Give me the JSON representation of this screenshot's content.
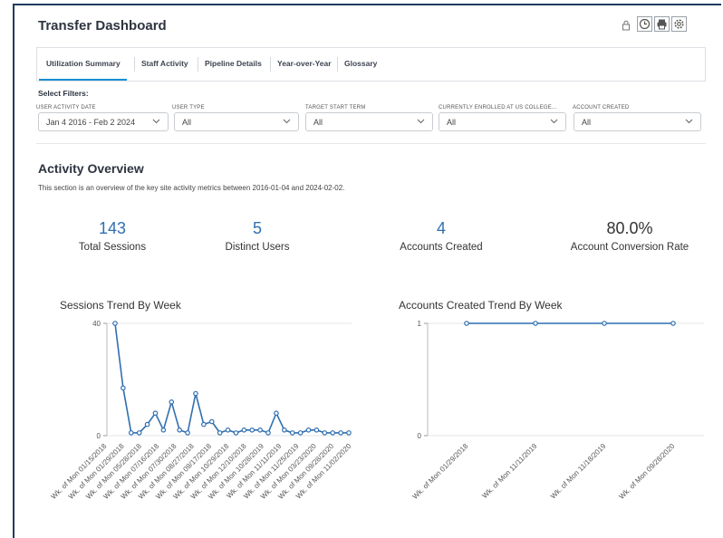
{
  "header": {
    "title": "Transfer Dashboard"
  },
  "toolbar": {
    "icons": [
      "lock-icon",
      "clock-icon",
      "print-icon",
      "gear-icon"
    ]
  },
  "tabs": [
    {
      "label": "Utilization Summary",
      "active": true
    },
    {
      "label": "Staff Activity",
      "active": false
    },
    {
      "label": "Pipeline Details",
      "active": false
    },
    {
      "label": "Year-over-Year",
      "active": false
    },
    {
      "label": "Glossary",
      "active": false
    }
  ],
  "filters": {
    "title": "Select Filters:",
    "items": [
      {
        "label": "USER ACTIVITY DATE",
        "value": "Jan 4 2016 - Feb 2 2024"
      },
      {
        "label": "USER TYPE",
        "value": "All"
      },
      {
        "label": "TARGET START TERM",
        "value": "All"
      },
      {
        "label": "CURRENTLY ENROLLED AT US COLLEGE...",
        "value": "All"
      },
      {
        "label": "ACCOUNT CREATED",
        "value": "All"
      }
    ]
  },
  "overview": {
    "title": "Activity Overview",
    "description": "This section is an overview of the key site activity metrics between 2016-01-04 and 2024-02-02.",
    "kpis": [
      {
        "value": "143",
        "label": "Total Sessions"
      },
      {
        "value": "5",
        "label": "Distinct Users"
      },
      {
        "value": "4",
        "label": "Accounts Created"
      },
      {
        "value": "80.0%",
        "label": "Account Conversion Rate"
      }
    ]
  },
  "colors": {
    "accent": "#1a8fd6",
    "series": "#2f6fb0",
    "kpi": "#2f6fb0"
  },
  "chart_data": [
    {
      "type": "line",
      "title": "Sessions Trend By Week",
      "ylim": [
        0,
        40
      ],
      "yticks": [
        0,
        40
      ],
      "grid": true,
      "x_tick_labels": [
        "Wk. of Mon 01/15/2018",
        "Wk. of Mon 01/29/2018",
        "Wk. of Mon 05/28/2018",
        "Wk. of Mon 07/16/2018",
        "Wk. of Mon 07/30/2018",
        "Wk. of Mon 08/27/2018",
        "Wk. of Mon 09/17/2018",
        "Wk. of Mon 10/29/2018",
        "Wk. of Mon 12/10/2018",
        "Wk. of Mon 10/28/2019",
        "Wk. of Mon 11/11/2019",
        "Wk. of Mon 11/25/2019",
        "Wk. of Mon 03/23/2020",
        "Wk. of Mon 09/28/2020",
        "Wk. of Mon 11/02/2020"
      ],
      "values": [
        40,
        17,
        1,
        1,
        4,
        8,
        2,
        12,
        2,
        1,
        15,
        4,
        5,
        1,
        2,
        1,
        2,
        2,
        2,
        1,
        8,
        2,
        1,
        1,
        2,
        2,
        1,
        1,
        1,
        1
      ]
    },
    {
      "type": "line",
      "title": "Accounts Created Trend By Week",
      "ylim": [
        0,
        1
      ],
      "yticks": [
        0,
        1
      ],
      "grid": true,
      "x_tick_labels": [
        "Wk. of Mon 01/29/2018",
        "Wk. of Mon 11/11/2019",
        "Wk. of Mon 11/18/2019",
        "Wk. of Mon 09/28/2020"
      ],
      "values": [
        1,
        1,
        1,
        1
      ]
    }
  ]
}
